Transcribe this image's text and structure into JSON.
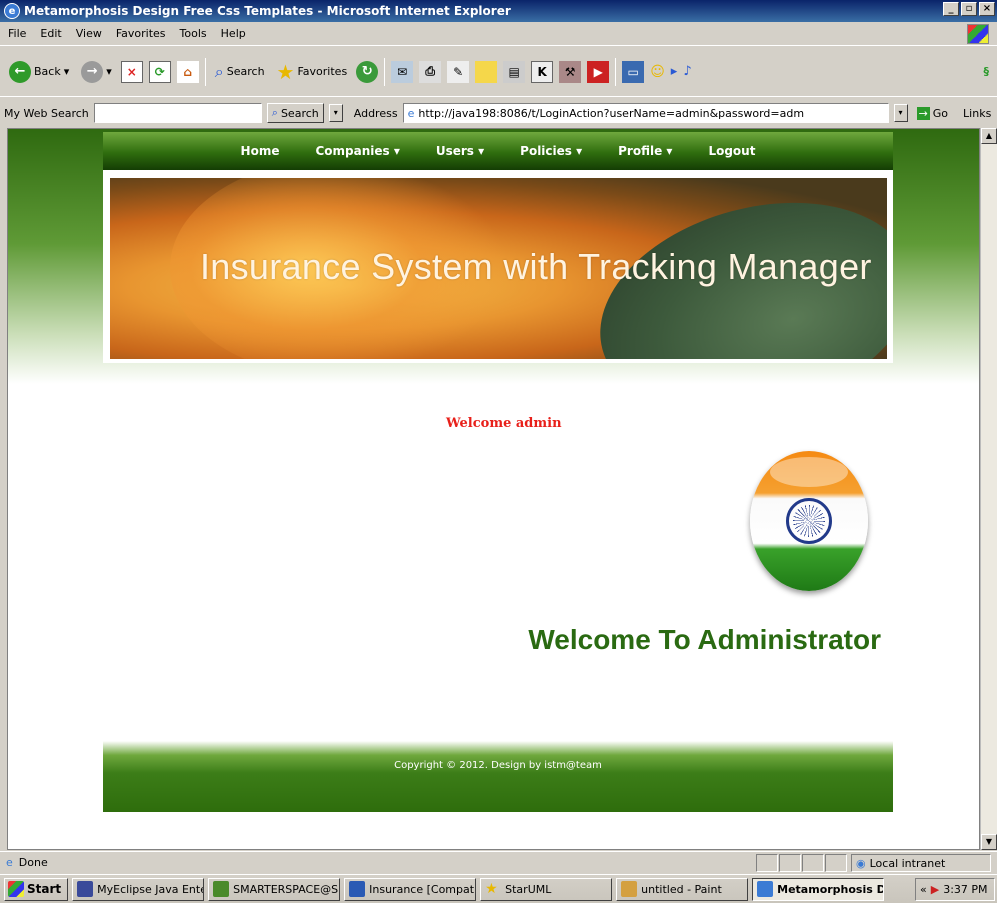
{
  "window": {
    "title": "Metamorphosis Design Free Css Templates - Microsoft Internet Explorer"
  },
  "menu": [
    "File",
    "Edit",
    "View",
    "Favorites",
    "Tools",
    "Help"
  ],
  "toolbar": {
    "back": "Back",
    "search": "Search",
    "favorites": "Favorites"
  },
  "addressbar": {
    "my_web_search": "My Web Search",
    "search_btn": "Search",
    "address_label": "Address",
    "url": "http://java198:8086/t/LoginAction?userName=admin&password=adm",
    "go": "Go",
    "links": "Links"
  },
  "nav": {
    "items": [
      "Home",
      "Companies ▾",
      "Users ▾",
      "Policies ▾",
      "Profile ▾",
      "Logout"
    ]
  },
  "banner": {
    "title": "Insurance System with Tracking Manager"
  },
  "page": {
    "welcome_user": "Welcome admin",
    "welcome_heading": "Welcome To Administrator"
  },
  "footer": {
    "copyright": "Copyright © 2012. Design by istm@team"
  },
  "status": {
    "text": "Done",
    "zone": "Local intranet"
  },
  "taskbar": {
    "start": "Start",
    "tasks": [
      "MyEclipse Java Ente...",
      "SMARTERSPACE@S...",
      "Insurance [Compati...",
      "StarUML",
      "untitled - Paint",
      "Metamorphosis D..."
    ],
    "clock": "3:37 PM"
  }
}
